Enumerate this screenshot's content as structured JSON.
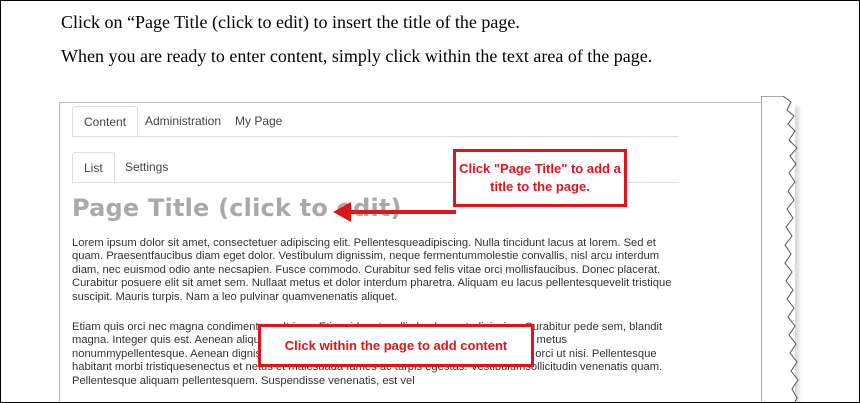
{
  "instructions": {
    "line1": "Click on “Page Title (click to edit) to insert the title of the page.",
    "line2": "When you are ready to enter content, simply click within the text area of the page."
  },
  "ui": {
    "top_tabs": [
      "Content",
      "Administration",
      "My Page"
    ],
    "sub_tabs": [
      "List",
      "Settings"
    ],
    "page_title": "Page Title (click to edit)",
    "paragraph1": "Lorem ipsum dolor sit amet, consectetuer adipiscing elit. Pellentesqueadipiscing. Nulla tincidunt lacus at lorem. Sed et quam. Praesentfaucibus diam eget dolor. Vestibulum dignissim, neque fermentummolestie convallis, nisl arcu interdum diam, nec euismod odio ante necsapien. Fusce commodo. Curabitur sed felis vitae orci mollisfaucibus. Donec placerat. Curabitur posuere elit sit amet sem. Nullaat metus et dolor interdum pharetra. Aliquam eu lacus pellentesquevelit tristique suscipit. Mauris turpis. Nam a leo pulvinar quamvenenatis aliquet.",
    "paragraph2": "Etiam quis orci nec magna condimentum ultrices. Etiam id erat mollis leo laoreetadipiscing. Curabitur pede sem, blandit magna. Integer quis est. Aenean aliquet,massa nec viverra iaculis justo. Donec sed eros eget metus nonummypellentesque. Aenean dignissim convallis, leo nisl mollis ligula, etscelerisque metus orci ut nisi. Pellentesque habitant morbi tristiquesenectus et netus et malesuada fames ac turpis egestas. Vestibulumsollicitudin venenatis quam. Pellentesque aliquam pellentesquem. Suspendisse venenatis, est vel"
  },
  "callouts": {
    "title_callout": "Click \"Page Title\" to add a title to the page.",
    "content_callout": "Click within the page to add content"
  },
  "colors": {
    "callout_red": "#e0141b",
    "title_gray": "#a9a9a9"
  }
}
